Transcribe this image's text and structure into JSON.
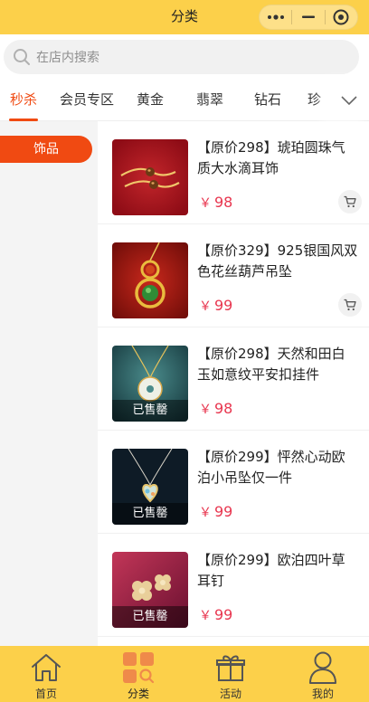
{
  "header": {
    "title": "分类"
  },
  "search": {
    "placeholder": "在店内搜索"
  },
  "tabs": [
    {
      "label": "秒杀",
      "active": true
    },
    {
      "label": "会员专区",
      "active": false
    },
    {
      "label": "黄金",
      "active": false
    },
    {
      "label": "翡翠",
      "active": false
    },
    {
      "label": "钻石",
      "active": false
    },
    {
      "label": "珍",
      "active": false
    }
  ],
  "sidebar": {
    "items": [
      {
        "label": "饰品",
        "active": true
      }
    ]
  },
  "products": [
    {
      "name": "【原价298】琥珀圆珠气质大水滴耳饰",
      "currency": "￥",
      "price": "98",
      "sold_out": false,
      "sold_label": ""
    },
    {
      "name": "【原价329】925银国风双色花丝葫芦吊坠",
      "currency": "￥",
      "price": "99",
      "sold_out": false,
      "sold_label": ""
    },
    {
      "name": "【原价298】天然和田白玉如意纹平安扣挂件",
      "currency": "￥",
      "price": "98",
      "sold_out": true,
      "sold_label": "已售罄"
    },
    {
      "name": "【原价299】怦然心动欧泊小吊坠仅一件",
      "currency": "￥",
      "price": "99",
      "sold_out": true,
      "sold_label": "已售罄"
    },
    {
      "name": "【原价299】欧泊四叶草耳钉",
      "currency": "￥",
      "price": "99",
      "sold_out": true,
      "sold_label": "已售罄"
    }
  ],
  "tabbar": {
    "items": [
      {
        "label": "首页",
        "icon": "home-icon"
      },
      {
        "label": "分类",
        "icon": "category-icon",
        "active": true
      },
      {
        "label": "活动",
        "icon": "gift-icon"
      },
      {
        "label": "我的",
        "icon": "user-icon"
      }
    ]
  },
  "colors": {
    "brand": "#fcd04a",
    "accent": "#f04a12",
    "price": "#e8364f"
  }
}
